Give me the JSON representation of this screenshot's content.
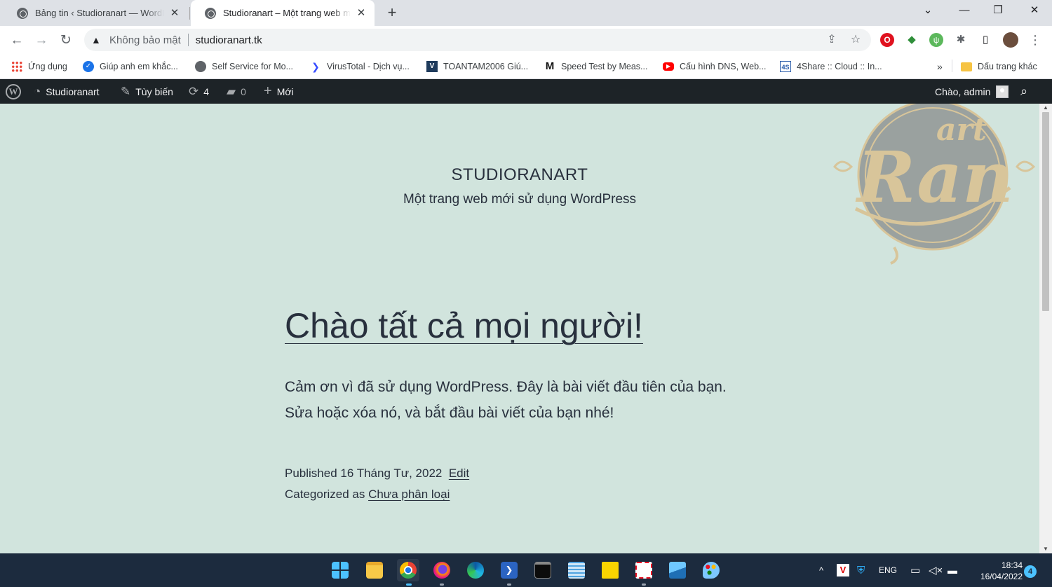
{
  "browser": {
    "tabs": [
      {
        "title": "Bảng tin ‹ Studioranart — WordPress",
        "active": false
      },
      {
        "title": "Studioranart – Một trang web mới sử dụng WordPress",
        "active": true
      }
    ],
    "close_glyph": "✕",
    "newtab_glyph": "+",
    "window_controls": {
      "tab_search": "⌄",
      "minimize": "—",
      "restore": "❐",
      "close": "✕"
    },
    "nav": {
      "back": "←",
      "forward": "→",
      "reload": "↻"
    },
    "address": {
      "warning_icon": "▲",
      "security_label": "Không bảo mật",
      "url": "studioranart.tk"
    },
    "omnibox_icons": {
      "share": "⇪",
      "star": "☆"
    },
    "extensions": {
      "opera": "O",
      "ext2": "◆",
      "ext3": "ψ",
      "puzzle": "✱",
      "sidepanel": "▯",
      "menu": "⋮"
    },
    "bookmarks": [
      {
        "label": "Ứng dụng",
        "icon": "apps-icon"
      },
      {
        "label": "Giúp anh em khắc...",
        "icon": "check-icon"
      },
      {
        "label": "Self Service for Mo...",
        "icon": "globe-icon"
      },
      {
        "label": "VirusTotal - Dịch vụ...",
        "icon": "virustotal-icon"
      },
      {
        "label": "TOANTAM2006 Giú...",
        "icon": "vt-icon"
      },
      {
        "label": "Speed Test by Meas...",
        "icon": "m-icon"
      },
      {
        "label": "Cấu hình DNS, Web...",
        "icon": "youtube-icon"
      },
      {
        "label": "4Share :: Cloud :: In...",
        "icon": "4share-icon"
      }
    ],
    "bookmarks_overflow": "»",
    "other_bookmarks": "Dấu trang khác"
  },
  "adminbar": {
    "wp_logo": "W",
    "site_name": "Studioranart",
    "customize": "Tùy biến",
    "updates_count": "4",
    "comments_count": "0",
    "new": "Mới",
    "greeting": "Chào, admin",
    "search_icon": "⌕"
  },
  "site": {
    "title": "STUDIORANART",
    "description": "Một trang web mới sử dụng WordPress"
  },
  "post": {
    "title": "Chào tất cả mọi người!",
    "body_line1": "Cảm ơn vì đã sử dụng WordPress. Đây là bài viết đầu tiên của bạn.",
    "body_line2": "Sửa hoặc xóa nó, và bắt đầu bài viết của bạn nhé!",
    "published_label": "Published 16 Tháng Tư, 2022",
    "edit_label": "Edit",
    "categorized_label": "Categorized as",
    "category": "Chưa phân loại"
  },
  "logo": {
    "line1": "art",
    "line2": "Ran"
  },
  "scrollbar": {
    "up": "▲",
    "down": "▼"
  },
  "taskbar": {
    "tray_chevron": "^",
    "language": "ENG",
    "time": "18:34",
    "date": "16/04/2022",
    "notifications": "4"
  },
  "colors": {
    "page_bg": "#d1e4dd",
    "text": "#28303d",
    "adminbar_bg": "#1d2327",
    "taskbar_bg": "#1c2b3e",
    "logo_gold": "#d8c59a",
    "logo_gray": "#9aa19f"
  }
}
